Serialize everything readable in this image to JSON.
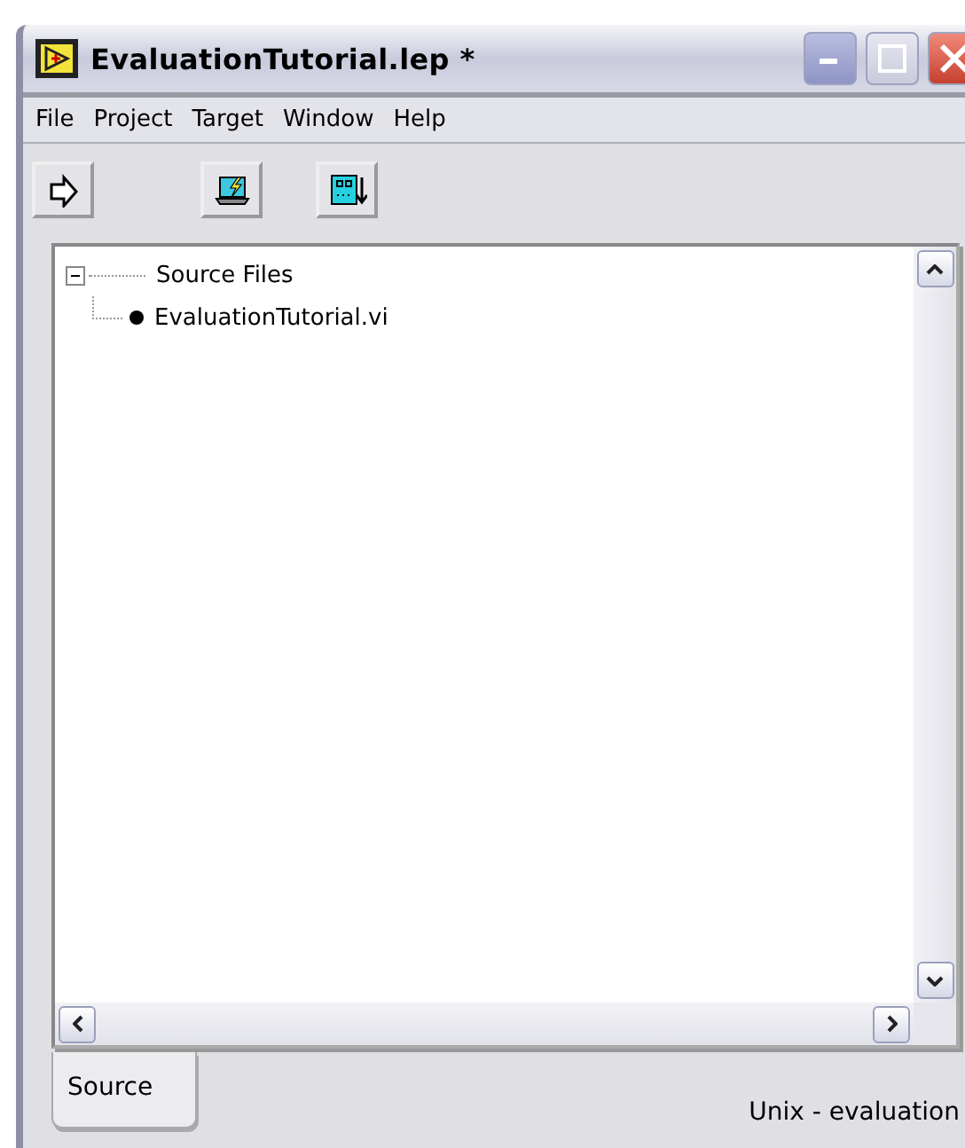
{
  "window": {
    "title": "EvaluationTutorial.lep *"
  },
  "menu": [
    {
      "label": "File"
    },
    {
      "label": "Project"
    },
    {
      "label": "Target"
    },
    {
      "label": "Window"
    },
    {
      "label": "Help"
    }
  ],
  "toolbar": [
    {
      "kind": "arrow"
    },
    {
      "kind": "build"
    },
    {
      "kind": "download"
    }
  ],
  "tree": [
    {
      "label": "Source Files",
      "expanded": true,
      "children": [
        {
          "label": "EvaluationTutorial.vi"
        }
      ]
    }
  ],
  "tabs": [
    {
      "label": "Source",
      "selected": true
    }
  ],
  "status": "Unix - evaluation"
}
